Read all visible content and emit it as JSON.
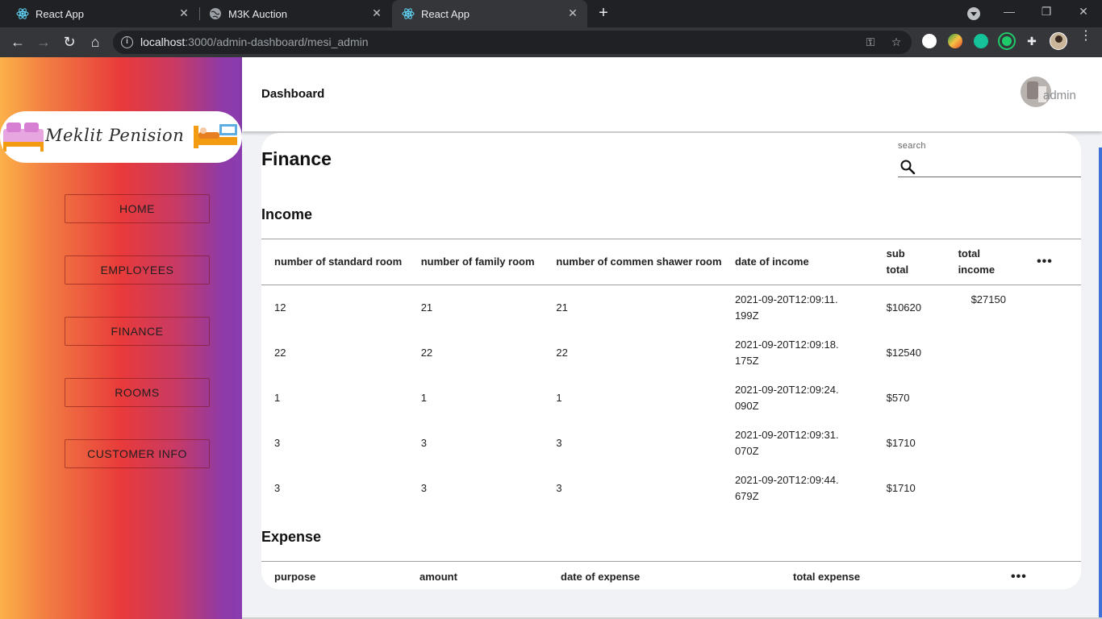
{
  "browser": {
    "tabs": [
      {
        "title": "React App",
        "icon": "react-icon",
        "active": false
      },
      {
        "title": "M3K Auction",
        "icon": "globe-icon",
        "active": false
      },
      {
        "title": "React App",
        "icon": "react-icon",
        "active": true
      }
    ],
    "url_host": "localhost",
    "url_path": ":3000/admin-dashboard/mesi_admin"
  },
  "sidebar": {
    "logo_text": "Meklit Penision",
    "items": [
      {
        "label": "HOME"
      },
      {
        "label": "EMPLOYEES"
      },
      {
        "label": "FINANCE"
      },
      {
        "label": "ROOMS"
      },
      {
        "label": "CUSTOMER INFO"
      }
    ]
  },
  "header": {
    "title": "Dashboard",
    "user_label": "admin"
  },
  "main": {
    "title": "Finance",
    "search_label": "search",
    "income": {
      "title": "Income",
      "columns": [
        "number of standard room",
        "number of family room",
        "number of commen shawer room",
        "date of income",
        "sub total",
        "total income"
      ],
      "rows": [
        {
          "standard": "12",
          "family": "21",
          "shower": "21",
          "date": "2021-09-20T12:09:11.199Z",
          "subtotal": "$10620",
          "total": "$27150"
        },
        {
          "standard": "22",
          "family": "22",
          "shower": "22",
          "date": "2021-09-20T12:09:18.175Z",
          "subtotal": "$12540",
          "total": ""
        },
        {
          "standard": "1",
          "family": "1",
          "shower": "1",
          "date": "2021-09-20T12:09:24.090Z",
          "subtotal": "$570",
          "total": ""
        },
        {
          "standard": "3",
          "family": "3",
          "shower": "3",
          "date": "2021-09-20T12:09:31.070Z",
          "subtotal": "$1710",
          "total": ""
        },
        {
          "standard": "3",
          "family": "3",
          "shower": "3",
          "date": "2021-09-20T12:09:44.679Z",
          "subtotal": "$1710",
          "total": ""
        }
      ]
    },
    "expense": {
      "title": "Expense",
      "columns": [
        "purpose",
        "amount",
        "date of expense",
        "total expense"
      ]
    }
  },
  "colors": {
    "sidebar_gradient": [
      "#fcb149",
      "#e83a3a",
      "#8a3cb0"
    ],
    "scroll_accent": "#3f6fd8"
  }
}
